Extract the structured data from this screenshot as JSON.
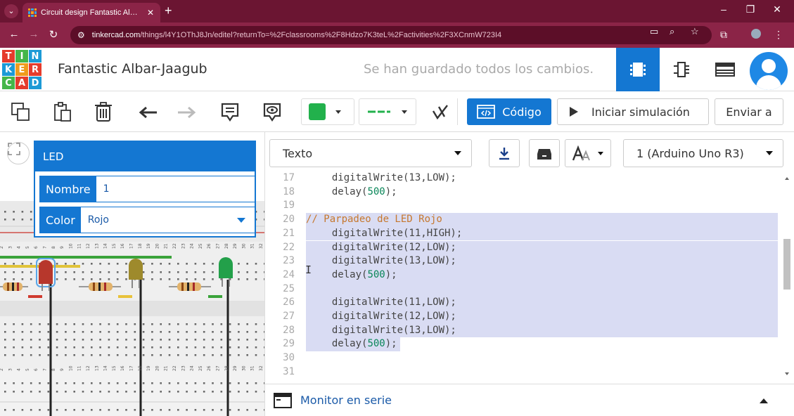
{
  "browser": {
    "tab_title": "Circuit design Fantastic Albar-Ja",
    "url_host": "tinkercad.com",
    "url_path": "/things/l4Y1OThJ8Jn/editel?returnTo=%2Fclassrooms%2F8Hdzo7K3teL%2Factivities%2F3XCnmW723I4",
    "new_tab_label": "+",
    "minimize_label": "–",
    "restore_label": "❐",
    "close_label": "✕"
  },
  "header": {
    "logo_letters": [
      "T",
      "I",
      "N",
      "K",
      "E",
      "R",
      "C",
      "A",
      "D"
    ],
    "project_title": "Fantastic Albar-Jaagub",
    "save_status": "Se han guardado todos los cambios."
  },
  "toolbar": {
    "component_color": "#22b14c",
    "code_button": "Código",
    "simulate_button": "Iniciar simulación",
    "send_button": "Enviar a"
  },
  "inspector": {
    "title": "LED",
    "name_label": "Nombre",
    "name_value": "1",
    "color_label": "Color",
    "color_value": "Rojo"
  },
  "code_panel": {
    "mode": "Texto",
    "board": "1 (Arduino Uno R3)",
    "serial_monitor": "Monitor en serie"
  },
  "code_lines": [
    {
      "n": "17",
      "segs": [
        [
          "t",
          "  digitalWrite(13,LOW);"
        ]
      ]
    },
    {
      "n": "18",
      "segs": [
        [
          "t",
          "  delay("
        ],
        [
          "n",
          "500"
        ],
        [
          "t",
          ");"
        ]
      ]
    },
    {
      "n": "19",
      "segs": []
    },
    {
      "n": "20",
      "segs": [
        [
          "c",
          "// Parpadeo de LED Rojo"
        ]
      ]
    },
    {
      "n": "21",
      "segs": [
        [
          "t",
          "  digitalWrite(11,HIGH);"
        ]
      ]
    },
    {
      "n": "22",
      "segs": [
        [
          "t",
          "  digitalWrite(12,LOW);"
        ]
      ]
    },
    {
      "n": "23",
      "segs": [
        [
          "t",
          "  digitalWrite(13,LOW);"
        ]
      ]
    },
    {
      "n": "24",
      "segs": [
        [
          "t",
          "  delay("
        ],
        [
          "n",
          "500"
        ],
        [
          "t",
          ");"
        ]
      ]
    },
    {
      "n": "25",
      "segs": []
    },
    {
      "n": "26",
      "segs": [
        [
          "t",
          "  digitalWrite(11,LOW);"
        ]
      ]
    },
    {
      "n": "27",
      "segs": [
        [
          "t",
          "  digitalWrite(12,LOW);"
        ]
      ]
    },
    {
      "n": "28",
      "segs": [
        [
          "t",
          "  digitalWrite(13,LOW);"
        ]
      ]
    },
    {
      "n": "29",
      "segs": [
        [
          "t",
          "  delay("
        ],
        [
          "n",
          "500"
        ],
        [
          "t",
          ");"
        ]
      ]
    },
    {
      "n": "30",
      "segs": []
    },
    {
      "n": "31",
      "segs": []
    }
  ],
  "selected_range": [
    "20",
    "29"
  ],
  "breadboard": {
    "leds": [
      {
        "color": "#c0392b",
        "label": "red-led"
      },
      {
        "color": "#a08a2a",
        "label": "yellow-led"
      },
      {
        "color": "#23a04a",
        "label": "green-led"
      }
    ]
  }
}
